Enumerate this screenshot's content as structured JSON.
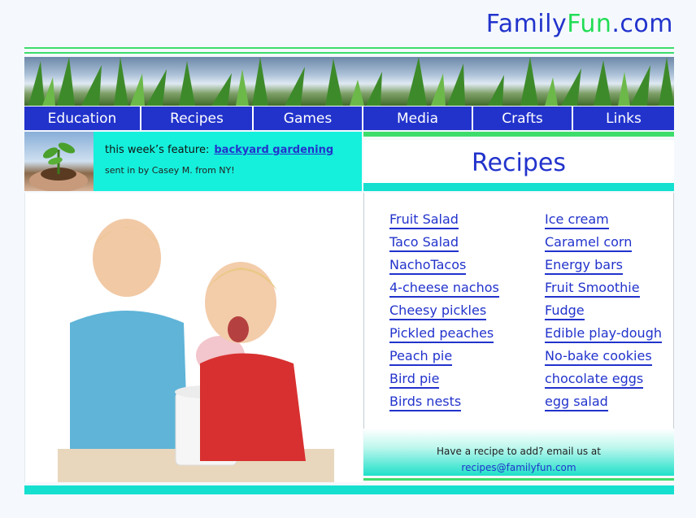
{
  "logo": {
    "part1": "Family",
    "part2": "Fun",
    "part3": ".com"
  },
  "nav": [
    "Education",
    "Recipes",
    "Games",
    "Media",
    "Crafts",
    "Links"
  ],
  "feature": {
    "label": "this week’s feature:",
    "link": "backyard gardening",
    "credit": "sent in by Casey M. from NY!"
  },
  "recipes": {
    "title": "Recipes",
    "left": [
      "Fruit Salad",
      "Taco Salad",
      "NachoTacos",
      "4-cheese nachos",
      "Cheesy pickles",
      "Pickled peaches",
      "Peach pie",
      "Bird pie",
      "Birds nests"
    ],
    "right": [
      "Ice cream",
      "Caramel corn",
      "Energy bars",
      "Fruit Smoothie",
      "Fudge",
      "Edible play-dough",
      "No-bake cookies",
      "chocolate eggs",
      "egg salad"
    ]
  },
  "submit": {
    "text": "Have a recipe to add? email us at",
    "email": "recipes@familyfun.com"
  },
  "colors": {
    "brand_blue": "#2233cc",
    "brand_green": "#22dd55",
    "aqua": "#15e0cf"
  }
}
